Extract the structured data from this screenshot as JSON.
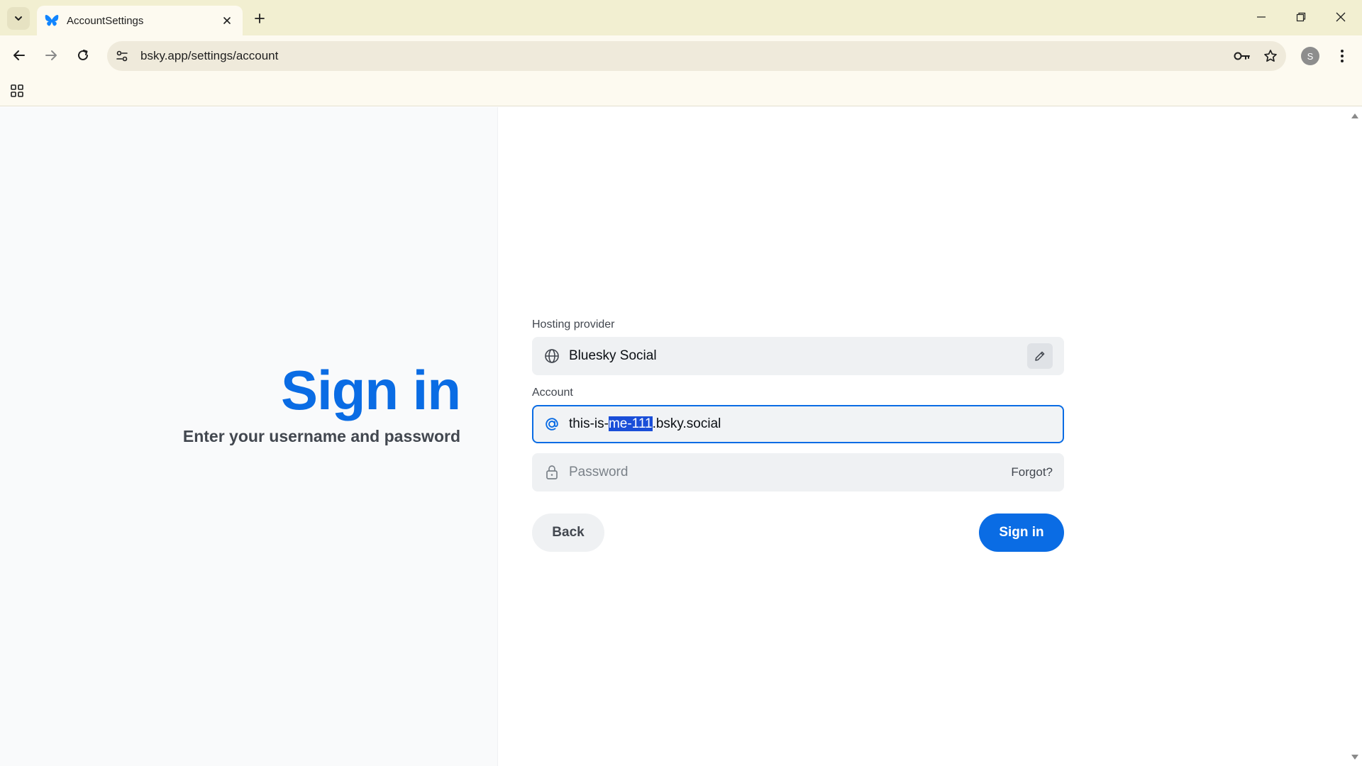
{
  "browser": {
    "tab_title": "AccountSettings",
    "url": "bsky.app/settings/account",
    "profile_initial": "S",
    "icons": {
      "tab_search": "chevron-down-icon",
      "favicon": "butterfly-icon",
      "tab_close": "close-icon",
      "new_tab": "plus-icon",
      "minimize": "minimize-icon",
      "restore": "restore-icon",
      "close_window": "close-icon",
      "back": "arrow-left-icon",
      "forward": "arrow-right-icon",
      "reload": "reload-icon",
      "site_info": "tune-icon",
      "password_key": "key-icon",
      "bookmark": "star-icon",
      "menu": "more-vertical-icon",
      "apps": "grid-icon"
    }
  },
  "signin": {
    "heading": "Sign in",
    "subheading": "Enter your username and password",
    "hosting_label": "Hosting provider",
    "hosting_value": "Bluesky Social",
    "account_label": "Account",
    "account_value_prefix": "this-is-",
    "account_value_selected": "me-111",
    "account_value_suffix": ".bsky.social",
    "password_placeholder": "Password",
    "forgot_label": "Forgot?",
    "back_label": "Back",
    "signin_label": "Sign in"
  },
  "colors": {
    "brand_blue": "#0a6ce4",
    "selection": "#1a4ed8",
    "chrome_bg": "#f2efd1"
  }
}
